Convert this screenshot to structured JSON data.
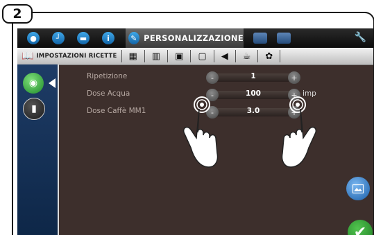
{
  "step_badge": "2",
  "topbar": {
    "active_tab": "PERSONALIZZAZIONE",
    "icons": [
      "water-drop-icon",
      "clock-icon",
      "book-icon",
      "info-icon",
      "pencil-icon",
      "grid-icon",
      "person-icon",
      "wrench-icon"
    ]
  },
  "subbar": {
    "active_label": "IMPOSTAZIONI RICETTE"
  },
  "rows": [
    {
      "label": "Ripetizione",
      "value": "1",
      "unit": ""
    },
    {
      "label": "Dose Acqua",
      "value": "100",
      "unit": "imp"
    },
    {
      "label": "Dose Caffè MM1",
      "value": "3.0",
      "unit": ""
    }
  ],
  "controls": {
    "minus": "-",
    "plus": "+"
  },
  "colors": {
    "accent": "#1b5fa8",
    "ok": "#1d7b23",
    "panel": "#3d2f2c"
  }
}
